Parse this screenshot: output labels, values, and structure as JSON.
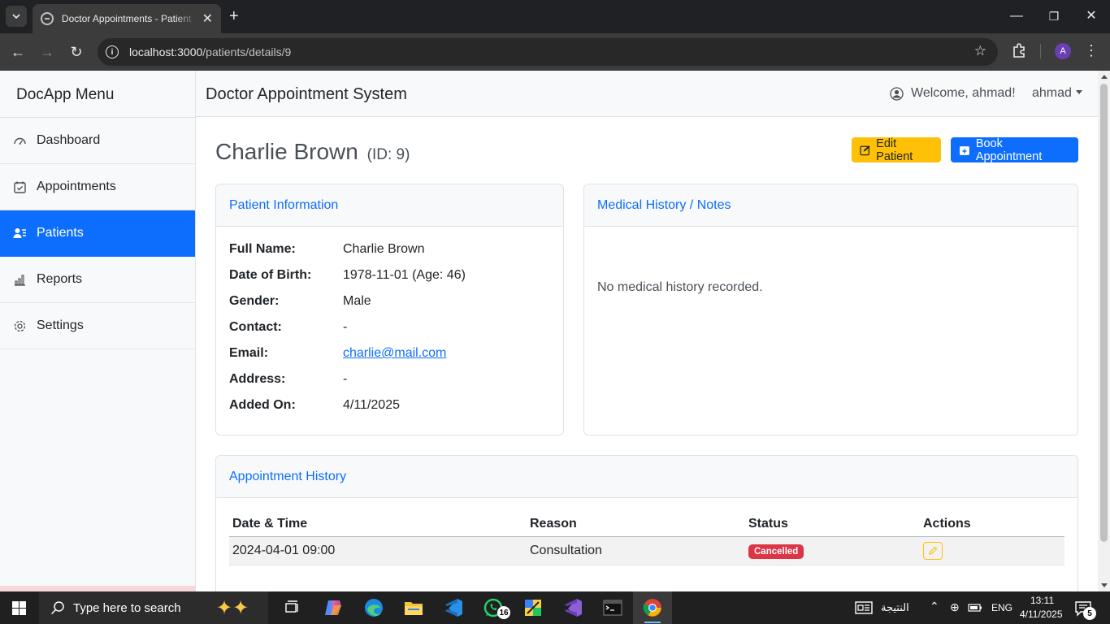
{
  "browser": {
    "tab_title": "Doctor Appointments - Patient",
    "url_host": "localhost:3000",
    "url_path": "/patients/details/9",
    "profile_initial": "A"
  },
  "sidebar": {
    "heading": "DocApp Menu",
    "items": [
      {
        "label": "Dashboard",
        "icon": "dashboard-gauge-icon",
        "active": false
      },
      {
        "label": "Appointments",
        "icon": "calendar-check-icon",
        "active": false
      },
      {
        "label": "Patients",
        "icon": "person-lines-icon",
        "active": true
      },
      {
        "label": "Reports",
        "icon": "bar-chart-icon",
        "active": false
      },
      {
        "label": "Settings",
        "icon": "gear-icon",
        "active": false
      }
    ]
  },
  "navbar": {
    "brand": "Doctor Appointment System",
    "welcome": "Welcome, ahmad!",
    "user": "ahmad"
  },
  "page": {
    "patient_name": "Charlie Brown",
    "patient_id_label": "(ID: 9)",
    "edit_button": "Edit Patient",
    "book_button": "Book Appointment"
  },
  "patient_info": {
    "title": "Patient Information",
    "fields": [
      {
        "label": "Full Name:",
        "value": "Charlie Brown"
      },
      {
        "label": "Date of Birth:",
        "value": "1978-11-01 (Age: 46)"
      },
      {
        "label": "Gender:",
        "value": "Male"
      },
      {
        "label": "Contact:",
        "value": "-"
      },
      {
        "label": "Email:",
        "value": "charlie@mail.com"
      },
      {
        "label": "Address:",
        "value": "-"
      },
      {
        "label": "Added On:",
        "value": "4/11/2025"
      }
    ]
  },
  "medical_history": {
    "title": "Medical History / Notes",
    "empty_text": "No medical history recorded."
  },
  "appointments": {
    "title": "Appointment History",
    "columns": [
      "Date & Time",
      "Reason",
      "Status",
      "Actions"
    ],
    "rows": [
      {
        "datetime": "2024-04-01 09:00",
        "reason": "Consultation",
        "status": "Cancelled"
      }
    ]
  },
  "taskbar": {
    "search_placeholder": "Type here to search",
    "whatsapp_badge": "16",
    "news_label": "النتيجة",
    "language": "ENG",
    "time": "13:11",
    "date": "4/11/2025",
    "notifications": "5"
  },
  "colors": {
    "primary": "#0d6efd",
    "warning": "#ffc107",
    "danger": "#dc3545"
  }
}
